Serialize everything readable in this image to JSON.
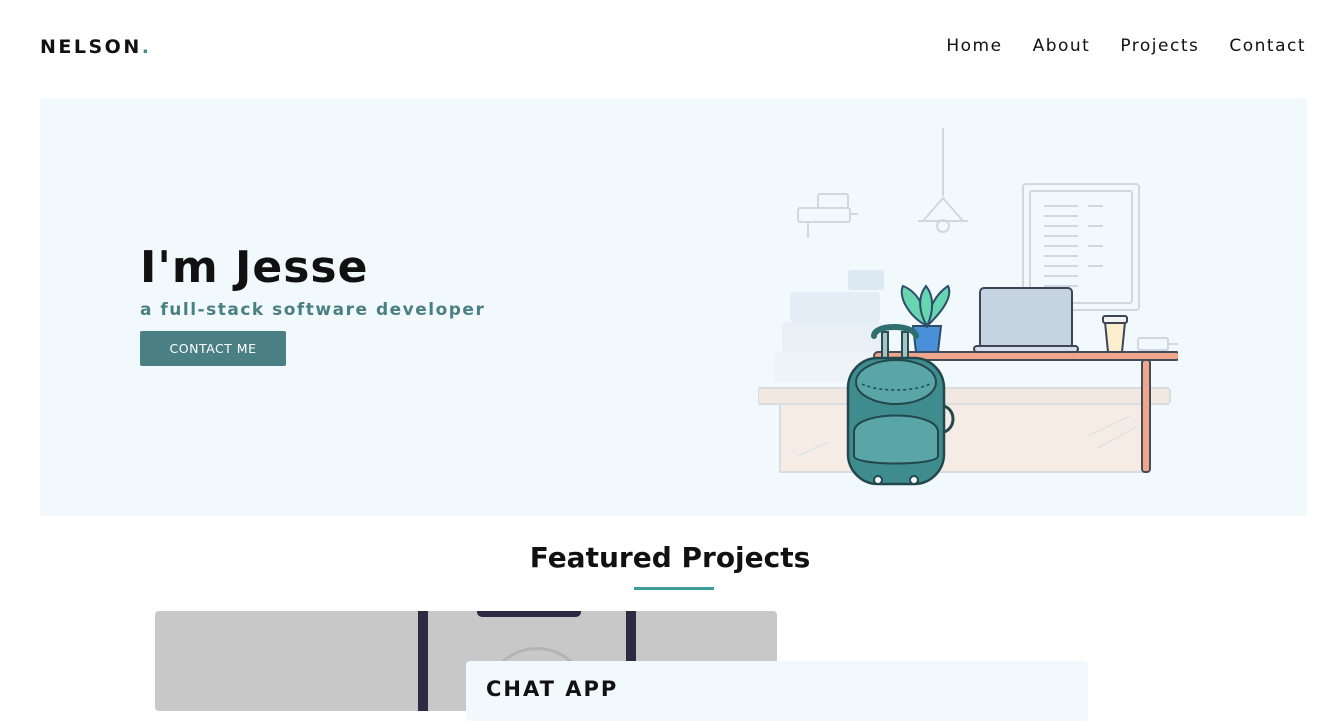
{
  "header": {
    "logo_text": "NELSON",
    "logo_dot": ".",
    "nav": [
      "Home",
      "About",
      "Projects",
      "Contact"
    ]
  },
  "hero": {
    "title": "I'm Jesse",
    "subtitle": "a full-stack software developer",
    "button_label": "CONTACT ME",
    "illustration": "desk-with-laptop-plant-backpack-illustration"
  },
  "featured": {
    "title": "Featured Projects",
    "projects": [
      {
        "title": "CHAT APP",
        "image": "phone-mockup"
      }
    ]
  },
  "colors": {
    "accent": "#4a7f84",
    "underline": "#3d9c99",
    "hero_bg": "#f2f9fc",
    "text": "#111111"
  }
}
